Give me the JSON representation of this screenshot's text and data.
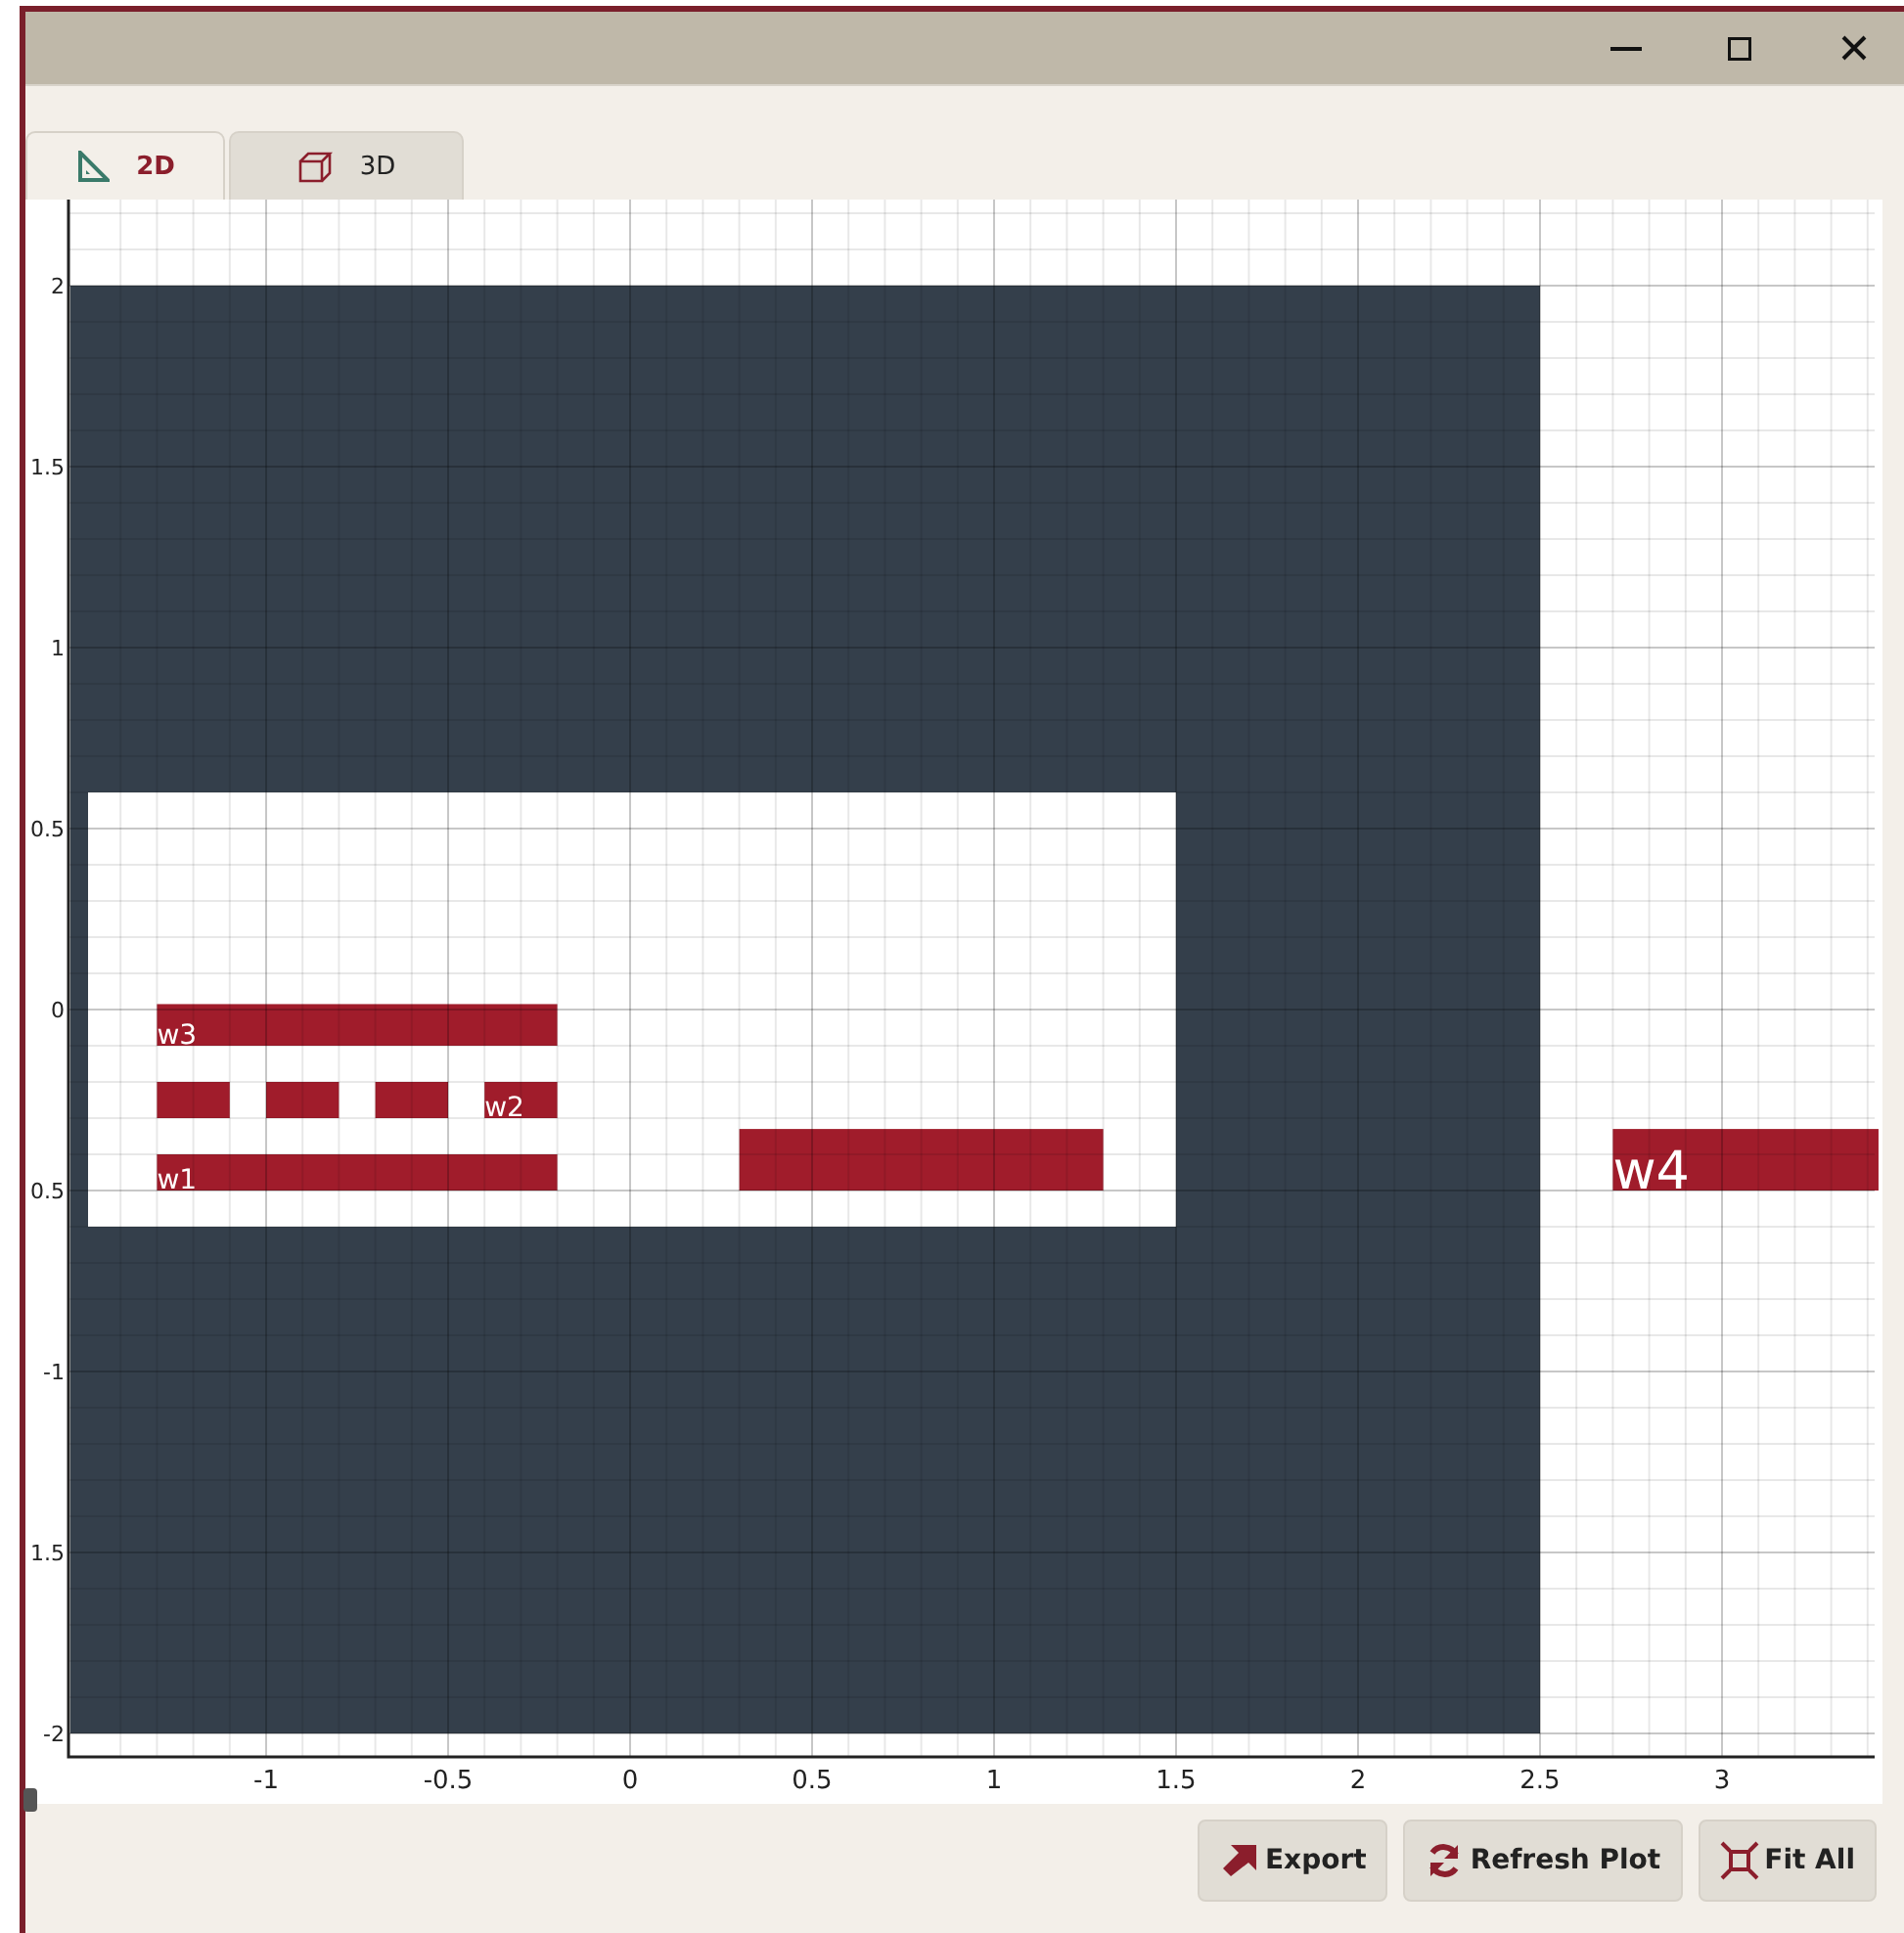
{
  "tabs": [
    {
      "label": "2D",
      "kind": "plan",
      "selected": true
    },
    {
      "label": "3D",
      "kind": "solid",
      "selected": false
    }
  ],
  "plot": {
    "y_tick_labels": [
      "2",
      "1.5",
      "1",
      "0.5",
      "0",
      "0.5",
      "-1",
      "1.5",
      "-2"
    ],
    "x_tick_labels": [
      "-1",
      "-0.5",
      "0",
      "0.5",
      "1",
      "1.5",
      "2",
      "2.5",
      "3"
    ],
    "wire_labels": [
      "w3",
      "w2",
      "w1",
      "w4"
    ]
  },
  "buttons": [
    {
      "label": "Export",
      "kind": "export"
    },
    {
      "label": "Refresh Plot",
      "kind": "refresh"
    },
    {
      "label": "Fit All",
      "kind": "fit"
    }
  ]
}
